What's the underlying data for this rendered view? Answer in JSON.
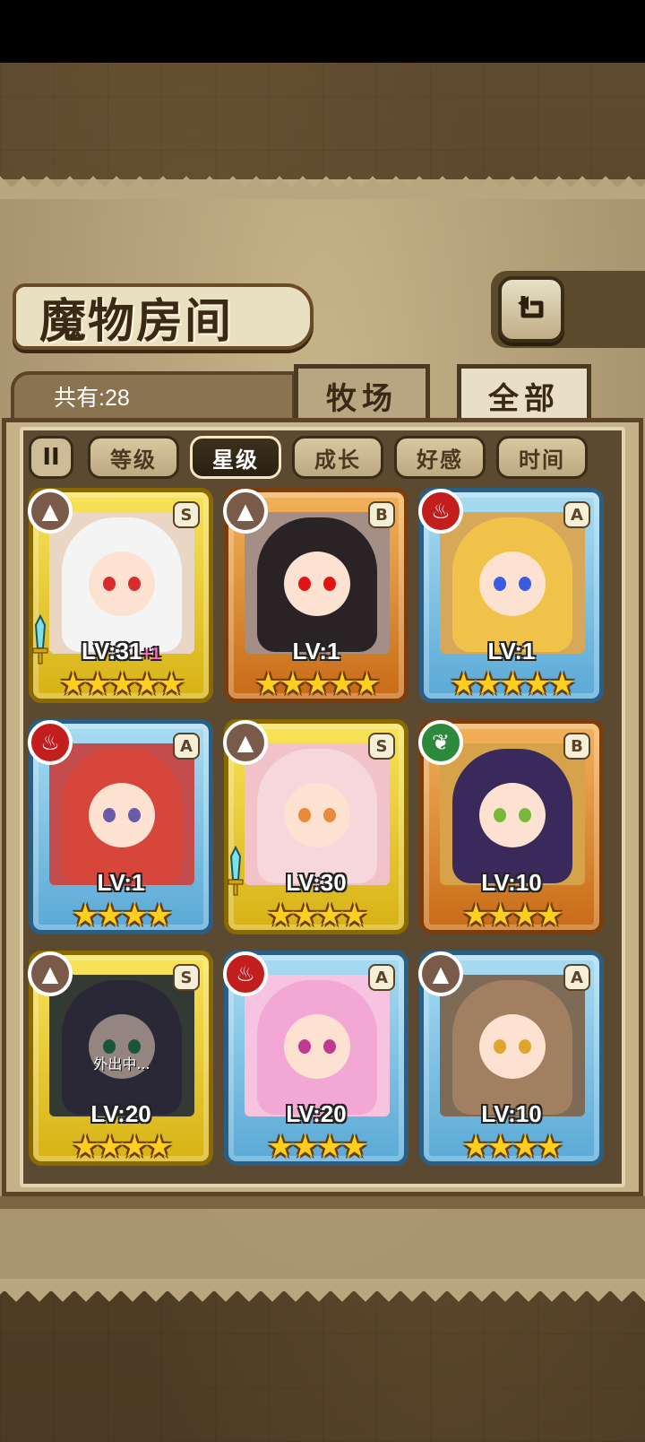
{
  "title": "魔物房间",
  "count_label": "共有:28",
  "tabs": {
    "ranch": "牧场",
    "all": "全部"
  },
  "sort": {
    "toggle": "II",
    "buttons": [
      "等级",
      "星级",
      "成长",
      "好感",
      "时间"
    ],
    "active": "星级"
  },
  "cards": [
    {
      "rank": "S",
      "frame": "gold",
      "element": "earth",
      "level": "LV:31",
      "level_plus": "+1",
      "stars": "★★★★★",
      "has_weapon": true,
      "hair": "#f4f4f4",
      "bg": "#e9d6c5",
      "eyes": "#d92b2b",
      "status": ""
    },
    {
      "rank": "B",
      "frame": "bronze",
      "element": "earth",
      "level": "LV:1",
      "level_plus": "",
      "stars": "★★★★★",
      "has_weapon": false,
      "hair": "#2a2326",
      "bg": "#a48e86",
      "eyes": "#e01414",
      "status": ""
    },
    {
      "rank": "A",
      "frame": "blue",
      "element": "fire",
      "level": "LV:1",
      "level_plus": "",
      "stars": "★★★★★",
      "has_weapon": false,
      "hair": "#f0c24a",
      "bg": "#d7a75a",
      "eyes": "#3a5de0",
      "status": ""
    },
    {
      "rank": "A",
      "frame": "blue",
      "element": "fire",
      "level": "LV:1",
      "level_plus": "",
      "stars": "★★★★",
      "has_weapon": false,
      "hair": "#d6463a",
      "bg": "#c44c4c",
      "eyes": "#6a5aa8",
      "status": ""
    },
    {
      "rank": "S",
      "frame": "gold",
      "element": "earth",
      "level": "LV:30",
      "level_plus": "",
      "stars": "★★★★",
      "has_weapon": true,
      "hair": "#f6d7dc",
      "bg": "#f1c3c8",
      "eyes": "#e88a3a",
      "status": ""
    },
    {
      "rank": "B",
      "frame": "bronze",
      "element": "leaf",
      "level": "LV:10",
      "level_plus": "",
      "stars": "★★★★",
      "has_weapon": false,
      "hair": "#3a2a5c",
      "bg": "#d6a24a",
      "eyes": "#78b83a",
      "status": ""
    },
    {
      "rank": "S",
      "frame": "gold",
      "element": "earth",
      "level": "LV:20",
      "level_plus": "",
      "stars": "★★★★",
      "has_weapon": false,
      "hair": "#3c3a4c",
      "bg": "#4d5a44",
      "eyes": "#1f8a4a",
      "status": "外出中..."
    },
    {
      "rank": "A",
      "frame": "blue",
      "element": "fire",
      "level": "LV:20",
      "level_plus": "",
      "stars": "★★★★",
      "has_weapon": false,
      "hair": "#f3a7d4",
      "bg": "#f6c4e0",
      "eyes": "#c03b8f",
      "status": ""
    },
    {
      "rank": "A",
      "frame": "blue",
      "element": "earth",
      "level": "LV:10",
      "level_plus": "",
      "stars": "★★★★",
      "has_weapon": false,
      "hair": "#a27f60",
      "bg": "#7d6b57",
      "eyes": "#e0a32c",
      "status": ""
    }
  ]
}
